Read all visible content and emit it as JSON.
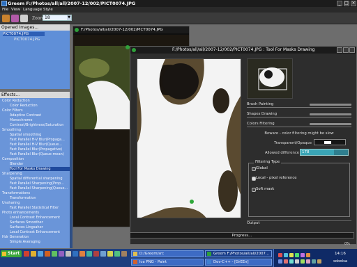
{
  "window": {
    "title": "Greem F:/Photos/all/all/2007-12/002/PICT0074.JPG"
  },
  "menu": [
    "File",
    "View",
    "Language",
    "Style"
  ],
  "toolbar": {
    "zoom_label": "Zoom:",
    "zoom_value": "18"
  },
  "opened_images": {
    "title": "Opened Images...",
    "items": [
      "PICT0074.JPG",
      "PICT0074.JPG"
    ]
  },
  "effects": {
    "title": "Effects...",
    "items": [
      "Color Reduction",
      "Color Reduction",
      "Color Filters",
      "Adaptive Contrast",
      "Monochrome",
      "Contrast/Brightness/Saturation",
      "Smoothing",
      "Spatial smoothing",
      "Fast Parallel H-V Blur(Propaga...",
      "Fast Parallel H-V Blur(Queue...",
      "Fast Parallel Blur(Propagative)",
      "Fast Parallel Blur(Queue-mean)",
      "Composition",
      "Blender",
      "Tool For Masks Drawing",
      "Sharpening",
      "Spatial differential sharpening",
      "Fast Parallel Sharpening(Prop...",
      "Fast Parallel Sharpening(Queue...",
      "Transformations",
      "Transformation",
      "Unsharing",
      "Fast Parallel Statistical Filter",
      "Photo enhancements",
      "Local Contrast Enhancement",
      "Surfaces Smoother",
      "Surfaces Lingsaher",
      "Local Contrast Enhancement",
      "Hdr Generation",
      "Simple Averaging"
    ]
  },
  "image_window": {
    "title": "F:/Photos/all/all/2007-12/002/PICT0074.JPG"
  },
  "tool_window": {
    "title": "F:/Photos/all/all/2007-12/002/PICT0074.JPG : Tool For Masks Drawing",
    "sections": [
      "Brush Painting",
      "Shapes Drawing",
      "Colors Filtering"
    ],
    "warning": "Beware - color filtering might be slow",
    "transparent_label": "Transparent/Opaque",
    "allowed_diff_label": "Allowed difference",
    "allowed_diff_value": "178",
    "allowed_diff_fraction": 0.7,
    "filtering_type_label": "Filtering Type",
    "filtering_options": [
      "Global",
      "Local - pixel reference",
      "Soft mask"
    ],
    "output_label": "Output",
    "progress_label": "Progress...",
    "progress_percent": "0%"
  },
  "taskbar": {
    "start": "Start",
    "tasks": [
      "D:/Greem/src",
      "Greem F:/Photos/all/all/2007...",
      "Ice PNG - Paint",
      "Dev-C++ - [GrEEn]"
    ],
    "clock": "14:16",
    "user": "sobolsa"
  },
  "colors": {
    "panel_blue": "#6a95d9",
    "taskbar_blue": "#1e3e7e",
    "highlight": "#1f4a9d"
  }
}
